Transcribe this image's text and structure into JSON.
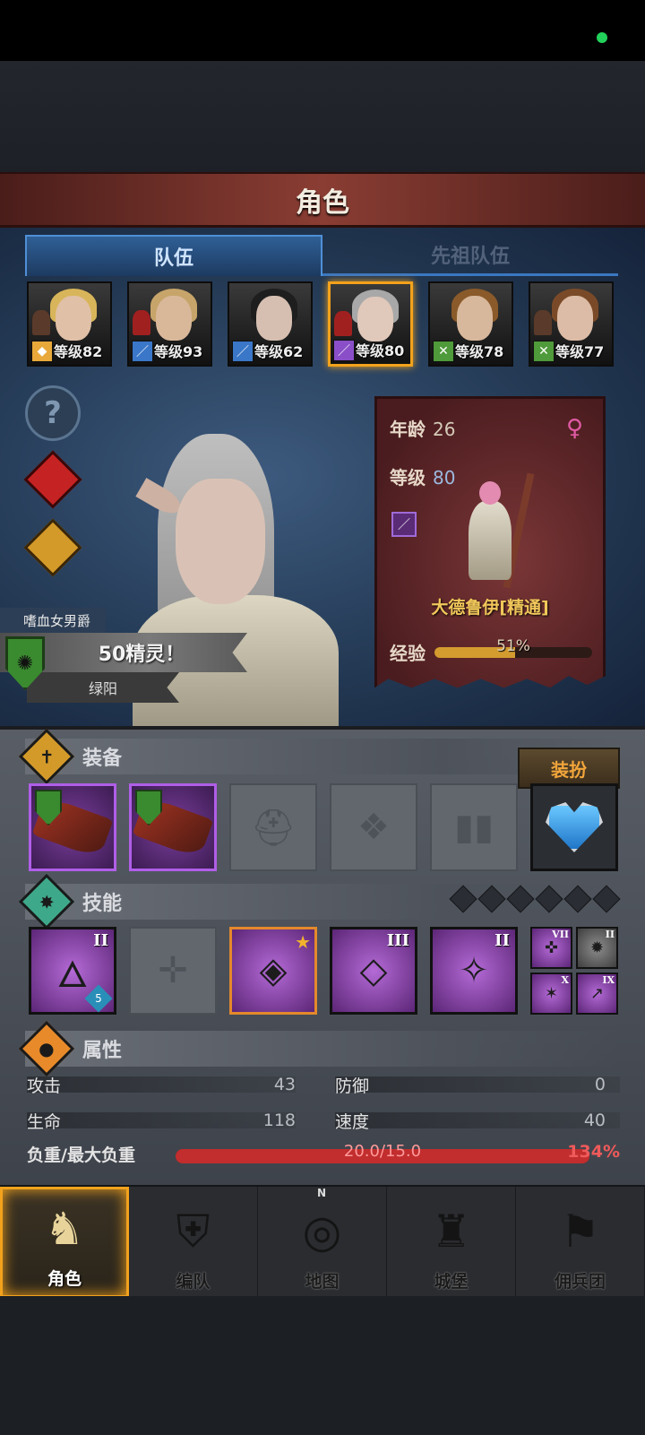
{
  "title": "角色",
  "tabs": [
    {
      "label": "队伍",
      "active": true
    },
    {
      "label": "先祖队伍",
      "active": false
    }
  ],
  "roster": [
    {
      "level_text": "等级82",
      "class_icon": "shield-class-icon",
      "class_color": "#e8a93a",
      "hair_color": "#d8b55a",
      "selected": false
    },
    {
      "level_text": "等级93",
      "class_icon": "sword-class-icon",
      "class_color": "#3a77c8",
      "hair_color": "#c7a56a",
      "selected": false
    },
    {
      "level_text": "等级62",
      "class_icon": "sword-class-icon",
      "class_color": "#3a77c8",
      "hair_color": "#1e1e1e",
      "selected": false
    },
    {
      "level_text": "等级80",
      "class_icon": "staff-class-icon",
      "class_color": "#8a4fc8",
      "hair_color": "#a8a8a8",
      "selected": true
    },
    {
      "level_text": "等级78",
      "class_icon": "bow-class-icon",
      "class_color": "#4f9a3a",
      "hair_color": "#8a5a2a",
      "selected": false
    },
    {
      "level_text": "等级77",
      "class_icon": "bow-class-icon",
      "class_color": "#4f9a3a",
      "hair_color": "#7a4a28",
      "selected": false
    }
  ],
  "hero": {
    "title_tag": "嗜血女男爵",
    "name": "50精灵！",
    "origin": "绿阳"
  },
  "info": {
    "age_label": "年龄",
    "age_value": "26",
    "level_label": "等级",
    "level_value": "80",
    "class_name": "大德鲁伊[精通]",
    "exp_label": "经验",
    "exp_text": "51%",
    "exp_fraction": 0.51,
    "gender_icon": "female-icon"
  },
  "equipment": {
    "title": "装备",
    "dress_button": "装扮",
    "slots": [
      "weapon-main",
      "weapon-off",
      "helmet-empty",
      "armor-empty",
      "boots-empty",
      "amulet-heart"
    ]
  },
  "skills": {
    "title": "技能",
    "items": [
      {
        "icon": "fire-skill-icon",
        "rank": "II",
        "badge": "5"
      },
      {
        "icon": "empty-skill-icon",
        "rank": "",
        "badge": ""
      },
      {
        "icon": "tornado-skill-icon",
        "rank": "",
        "badge": "",
        "starred": true
      },
      {
        "icon": "crystal-skill-icon",
        "rank": "III",
        "badge": ""
      },
      {
        "icon": "staff-skill-icon",
        "rank": "II",
        "badge": ""
      }
    ],
    "mini": [
      {
        "icon": "target-skill-icon",
        "rank": "VII"
      },
      {
        "icon": "burst-skill-icon",
        "rank": "II"
      },
      {
        "icon": "spark-skill-icon",
        "rank": "X"
      },
      {
        "icon": "spear-skill-icon",
        "rank": "IX"
      }
    ]
  },
  "attributes": {
    "title": "属性",
    "attack_label": "攻击",
    "attack_value": "43",
    "defense_label": "防御",
    "defense_value": "0",
    "hp_label": "生命",
    "hp_value": "118",
    "speed_label": "速度",
    "speed_value": "40",
    "load_label": "负重/最大负重",
    "load_text": "20.0/15.0",
    "load_percent": "134%"
  },
  "nav": [
    {
      "label": "角色",
      "icon": "knight-icon",
      "active": true
    },
    {
      "label": "编队",
      "icon": "helmet-icon",
      "active": false
    },
    {
      "label": "地图",
      "icon": "compass-icon",
      "active": false
    },
    {
      "label": "城堡",
      "icon": "castle-icon",
      "active": false
    },
    {
      "label": "佣兵团",
      "icon": "banner-icon",
      "active": false
    }
  ],
  "colors": {
    "accent_gold": "#f2a21c",
    "level_blue": "#9cb9e0",
    "overload_red": "#ef5a5a"
  }
}
